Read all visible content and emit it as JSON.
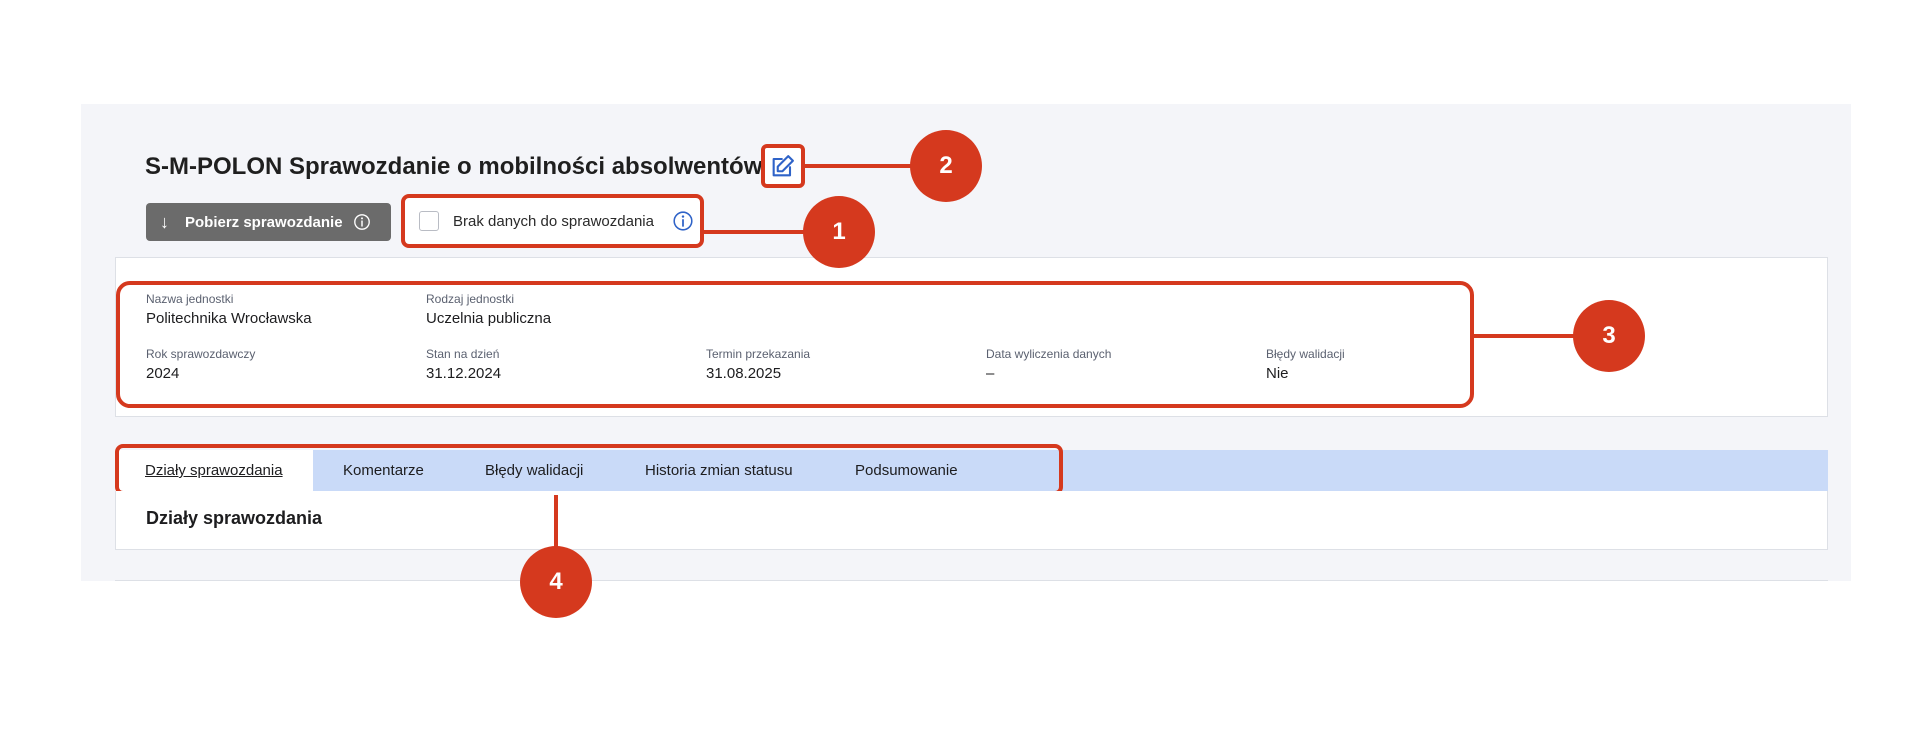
{
  "header": {
    "title": "S-M-POLON Sprawozdanie o mobilności absolwentów"
  },
  "actions": {
    "download_label": "Pobierz sprawozdanie",
    "no_data_label": "Brak danych do sprawozdania"
  },
  "report_info": {
    "fields": [
      {
        "label": "Nazwa jednostki",
        "value": "Politechnika Wrocławska"
      },
      {
        "label": "Rodzaj jednostki",
        "value": "Uczelnia publiczna"
      },
      {
        "label": "Rok sprawozdawczy",
        "value": "2024"
      },
      {
        "label": "Stan na dzień",
        "value": "31.12.2024"
      },
      {
        "label": "Termin przekazania",
        "value": "31.08.2025"
      },
      {
        "label": "Data wyliczenia danych",
        "value": "–"
      },
      {
        "label": "Błędy walidacji",
        "value": "Nie"
      }
    ]
  },
  "tabs": [
    {
      "label": "Działy sprawozdania",
      "active": true
    },
    {
      "label": "Komentarze"
    },
    {
      "label": "Błędy walidacji"
    },
    {
      "label": "Historia zmian statusu"
    },
    {
      "label": "Podsumowanie"
    }
  ],
  "section": {
    "title": "Działy sprawozdania"
  },
  "annotations": {
    "markers": [
      "1",
      "2",
      "3",
      "4"
    ]
  },
  "colors": {
    "accent_red": "#d5391e",
    "tab_bar_blue": "#c9daf8",
    "icon_blue": "#2f63c8",
    "button_grey": "#6b6b6b"
  },
  "icons": {
    "edit": "edit-icon",
    "info": "info-icon",
    "download": "arrow-down-icon"
  }
}
